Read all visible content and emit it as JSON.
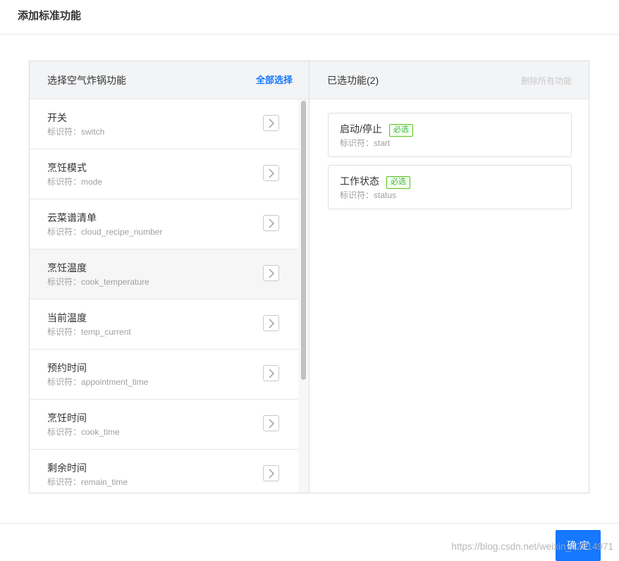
{
  "dialog": {
    "title": "添加标准功能"
  },
  "left": {
    "title": "选择空气炸锅功能",
    "select_all": "全部选择",
    "items": [
      {
        "name": "开关",
        "sub": "标识符：switch"
      },
      {
        "name": "烹饪模式",
        "sub": "标识符：mode"
      },
      {
        "name": "云菜谱清单",
        "sub": "标识符：cloud_recipe_number"
      },
      {
        "name": "烹饪温度",
        "sub": "标识符：cook_temperature"
      },
      {
        "name": "当前温度",
        "sub": "标识符：temp_current"
      },
      {
        "name": "预约时间",
        "sub": "标识符：appointment_time"
      },
      {
        "name": "烹饪时间",
        "sub": "标识符：cook_time"
      },
      {
        "name": "剩余时间",
        "sub": "标识符：remain_time"
      }
    ]
  },
  "right": {
    "title": "已选功能(2)",
    "clear_all": "删除所有功能",
    "items": [
      {
        "name": "启动/停止",
        "badge": "必选",
        "sub": "标识符：start"
      },
      {
        "name": "工作状态",
        "badge": "必选",
        "sub": "标识符：status"
      }
    ]
  },
  "footer": {
    "confirm": "确 定"
  },
  "watermark": "https://blog.csdn.net/weixin_42614971",
  "icons": {
    "add": "chevron-right-icon"
  },
  "colors": {
    "accent": "#1677ff",
    "badge_green": "#52c41a",
    "header_bg": "#f3f4f6"
  }
}
